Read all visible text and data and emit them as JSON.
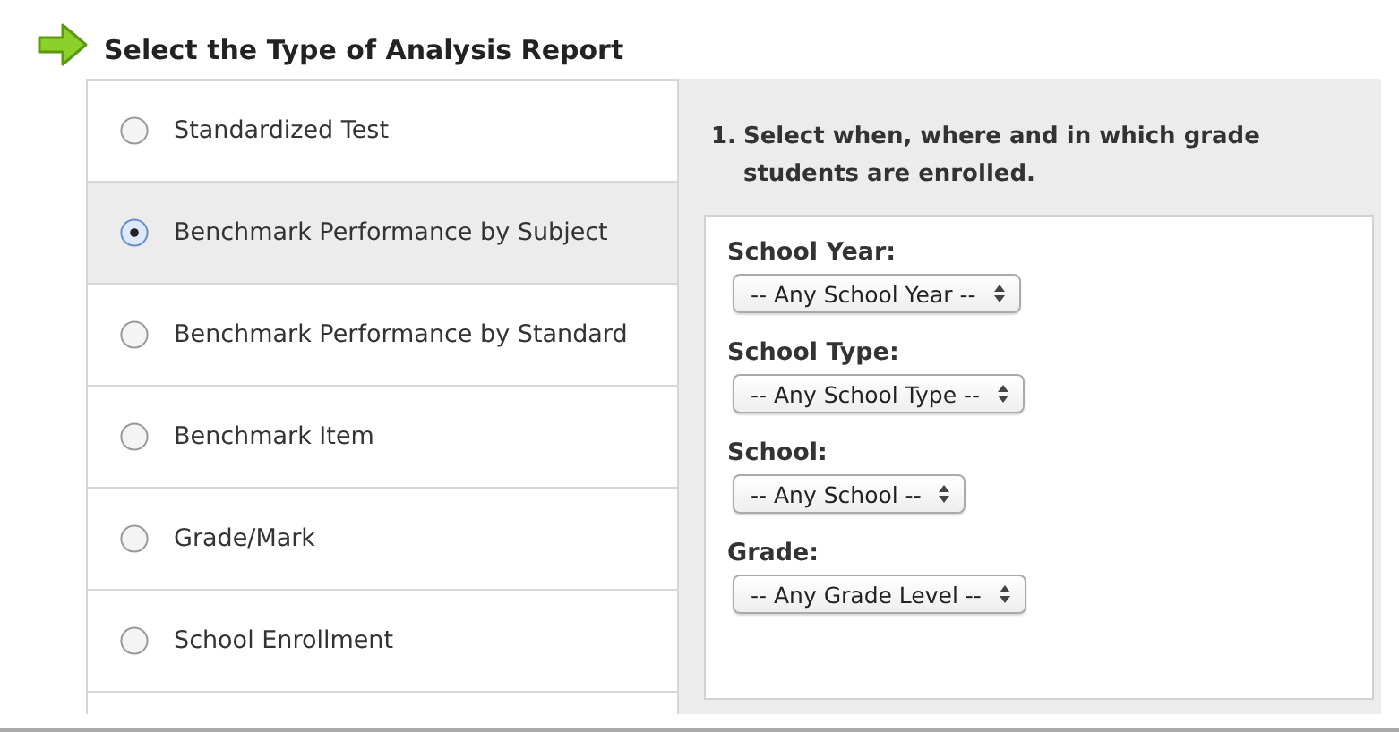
{
  "heading": "Select the Type of Analysis Report",
  "report_types": [
    {
      "label": "Standardized Test",
      "selected": false
    },
    {
      "label": "Benchmark Performance by Subject",
      "selected": true
    },
    {
      "label": "Benchmark Performance by Standard",
      "selected": false
    },
    {
      "label": "Benchmark Item",
      "selected": false
    },
    {
      "label": "Grade/Mark",
      "selected": false
    },
    {
      "label": "School Enrollment",
      "selected": false
    }
  ],
  "step": {
    "number": "1.",
    "text": "Select when, where and in which grade students are enrolled."
  },
  "filters": [
    {
      "label": "School Year:",
      "value": "-- Any School Year --"
    },
    {
      "label": "School Type:",
      "value": "-- Any School Type --"
    },
    {
      "label": "School:",
      "value": "-- Any School --"
    },
    {
      "label": "Grade:",
      "value": "-- Any Grade Level --"
    }
  ]
}
